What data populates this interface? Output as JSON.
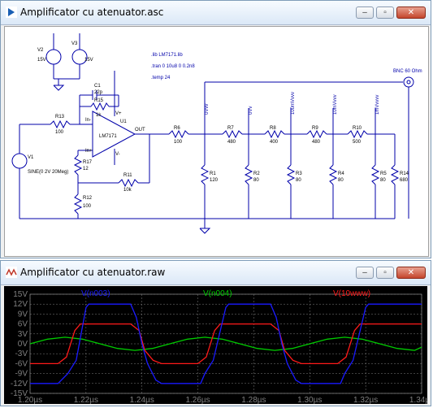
{
  "schematic_window": {
    "title": "Amplificator cu atenuator.asc",
    "buttons": {
      "minimize": "–",
      "restore": "▫",
      "close": "✕"
    },
    "directives": {
      "lib": ".lib LM7171.lib",
      "tran": ".tran 0 10u8 0 0.2n8",
      "temp": ".temp 24"
    },
    "bnc_label": "BNC 60 Ohm",
    "sources": {
      "V2": {
        "name": "V2",
        "value": "15V"
      },
      "V3": {
        "name": "V3",
        "value": "15V"
      },
      "V1": {
        "name": "V1",
        "value": "SINE(0 2V 20Meg)"
      }
    },
    "opamp": {
      "name": "U1",
      "part": "LM7171",
      "in_plus": "In+",
      "in_minus": "In-",
      "vplus": "V+",
      "vminus": "V-",
      "out": "OUT"
    },
    "components": {
      "C1": {
        "name": "C1",
        "value": "22p"
      },
      "R15": {
        "name": "R15",
        "value": "1k"
      },
      "R13": {
        "name": "R13",
        "value": "100"
      },
      "R17": {
        "name": "R17",
        "value": "12"
      },
      "R12": {
        "name": "R12",
        "value": "100"
      },
      "R11": {
        "name": "R11",
        "value": "10k"
      },
      "R6": {
        "name": "R6",
        "value": "100"
      },
      "R1": {
        "name": "R1",
        "value": "120"
      },
      "R7": {
        "name": "R7",
        "value": "480"
      },
      "R2": {
        "name": "R2",
        "value": "80"
      },
      "R8": {
        "name": "R8",
        "value": "400"
      },
      "R3": {
        "name": "R3",
        "value": "80"
      },
      "R9": {
        "name": "R9",
        "value": "480"
      },
      "R4": {
        "name": "R4",
        "value": "80"
      },
      "R10": {
        "name": "R10",
        "value": "500"
      },
      "R5": {
        "name": "R5",
        "value": "80"
      },
      "R14": {
        "name": "R14",
        "value": "680"
      }
    },
    "net_labels": [
      "0Vvv",
      "0Vv",
      "100mVvvv",
      "10mVvvv",
      "1mVvvvv"
    ]
  },
  "plot_window": {
    "title": "Amplificator cu atenuator.raw",
    "buttons": {
      "minimize": "–",
      "restore": "▫",
      "close": "✕"
    },
    "trace_labels": {
      "n003": "V(n003)",
      "n004": "V(n004)",
      "ww": "V(10www)"
    },
    "colors": {
      "n003": "#1a1aff",
      "n004": "#00cc00",
      "ww": "#ff1a1a",
      "background": "#000000",
      "grid": "#808080"
    },
    "chart_data": {
      "type": "line",
      "xlim": [
        1.2,
        1.34
      ],
      "ylim": [
        -15,
        15
      ],
      "x_ticks": [
        "1.20µs",
        "1.22µs",
        "1.24µs",
        "1.26µs",
        "1.28µs",
        "1.30µs",
        "1.32µs",
        "1.34µs"
      ],
      "y_ticks": [
        "15V",
        "12V",
        "9V",
        "6V",
        "3V",
        "0V",
        "-3V",
        "-6V",
        "-9V",
        "-12V",
        "-15V"
      ],
      "grid": true,
      "series": [
        {
          "name": "V(n003)",
          "x": [
            1.2,
            1.21,
            1.2135,
            1.2165,
            1.22,
            1.221,
            1.236,
            1.238,
            1.24,
            1.242,
            1.245,
            1.247,
            1.261,
            1.2625,
            1.2655,
            1.27,
            1.271,
            1.286,
            1.288,
            1.29,
            1.292,
            1.295,
            1.297,
            1.311,
            1.3125,
            1.3155,
            1.32,
            1.321,
            1.34
          ],
          "values": [
            -12,
            -12,
            -9,
            -5,
            11,
            12,
            12,
            8,
            0,
            -6,
            -11,
            -12,
            -12,
            -9,
            -5,
            11,
            12,
            12,
            8,
            0,
            -6,
            -11,
            -12,
            -12,
            -9,
            -5,
            11,
            12,
            12
          ]
        },
        {
          "name": "V(n004)",
          "x": [
            1.2,
            1.20625,
            1.2125,
            1.21875,
            1.225,
            1.23125,
            1.2375,
            1.24375,
            1.25,
            1.25625,
            1.2625,
            1.26875,
            1.275,
            1.28125,
            1.2875,
            1.29375,
            1.3,
            1.30625,
            1.3125,
            1.31875,
            1.325,
            1.33125,
            1.3375,
            1.34
          ],
          "values": [
            0,
            1.4,
            2,
            1.4,
            0,
            -1.4,
            -2,
            -1.4,
            0,
            1.4,
            2,
            1.4,
            0,
            -1.4,
            -2,
            -1.4,
            0,
            1.4,
            2,
            1.4,
            0,
            -1.4,
            -2,
            -1.0
          ]
        },
        {
          "name": "V(10www)",
          "x": [
            1.2,
            1.21,
            1.213,
            1.216,
            1.218,
            1.236,
            1.239,
            1.241,
            1.244,
            1.247,
            1.26,
            1.263,
            1.266,
            1.268,
            1.286,
            1.289,
            1.291,
            1.294,
            1.297,
            1.31,
            1.313,
            1.316,
            1.318,
            1.34
          ],
          "values": [
            -6,
            -6,
            -4,
            4,
            6,
            6,
            4,
            -2,
            -5,
            -6,
            -6,
            -4,
            4,
            6,
            6,
            4,
            -2,
            -5,
            -6,
            -6,
            -4,
            4,
            6,
            6
          ]
        }
      ]
    }
  }
}
